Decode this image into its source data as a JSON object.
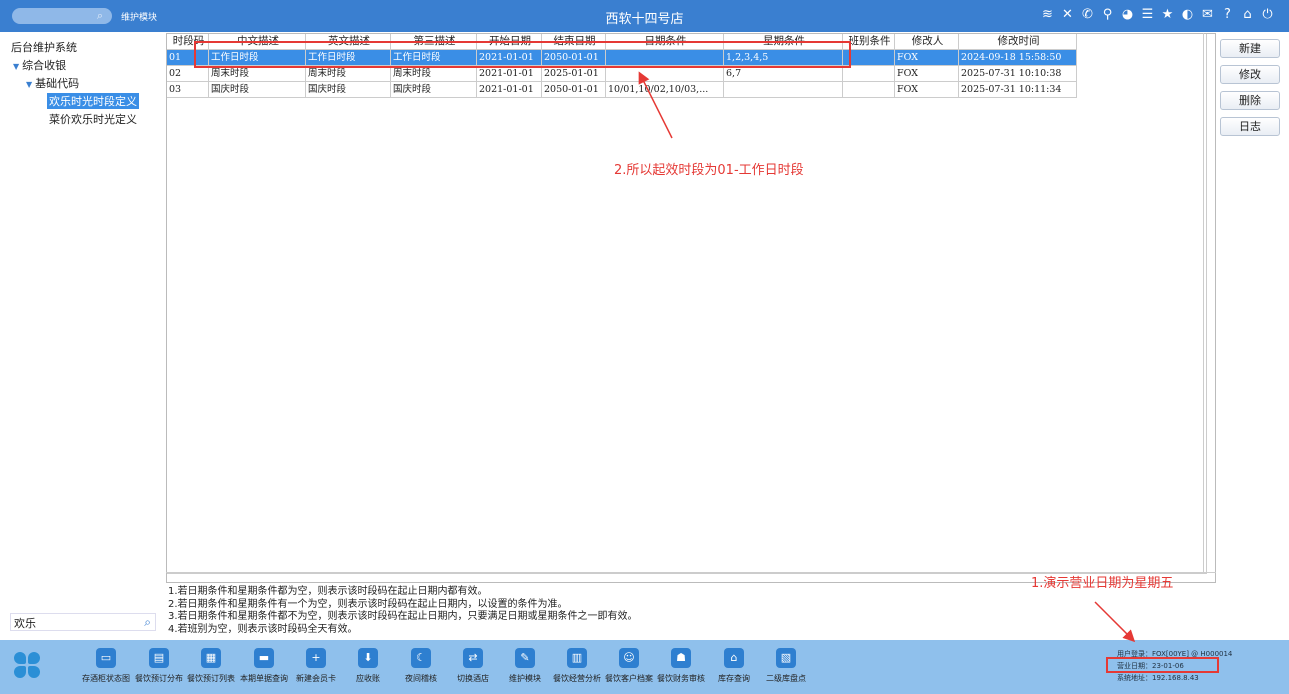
{
  "topbar": {
    "module_label": "维护模块",
    "store_title": "西软十四号店",
    "icons": [
      "wifi-icon",
      "tools-icon",
      "phone-icon",
      "search-person-icon",
      "palette-icon",
      "menu-icon",
      "star-icon",
      "theme-icon",
      "mail-icon",
      "help-icon",
      "home-icon",
      "power-icon"
    ]
  },
  "sidebar": {
    "root": "后台维护系统",
    "group": "综合收银",
    "sub": "基础代码",
    "item_selected": "欢乐时光时段定义",
    "item_other": "菜价欢乐时光定义",
    "search_value": "欢乐"
  },
  "table": {
    "headers": [
      "时段码",
      "中文描述",
      "英文描述",
      "第三描述",
      "开始日期",
      "结束日期",
      "日期条件",
      "星期条件",
      "班别条件",
      "修改人",
      "修改时间"
    ],
    "rows": [
      [
        "01",
        "工作日时段",
        "工作日时段",
        "工作日时段",
        "2021-01-01",
        "2050-01-01",
        "",
        "1,2,3,4,5",
        "",
        "FOX",
        "2024-09-18 15:58:50"
      ],
      [
        "02",
        "周末时段",
        "周末时段",
        "周末时段",
        "2021-01-01",
        "2025-01-01",
        "",
        "6,7",
        "",
        "FOX",
        "2025-07-31 10:10:38"
      ],
      [
        "03",
        "国庆时段",
        "国庆时段",
        "国庆时段",
        "2021-01-01",
        "2050-01-01",
        "10/01,10/02,10/03,...",
        "",
        "",
        "FOX",
        "2025-07-31 10:11:34"
      ]
    ]
  },
  "notes": [
    "1.若日期条件和星期条件都为空，则表示该时段码在起止日期内都有效。",
    "2.若日期条件和星期条件有一个为空，则表示该时段码在起止日期内，以设置的条件为准。",
    "3.若日期条件和星期条件都不为空，则表示该时段码在起止日期内，只要满足日期或星期条件之一即有效。",
    "4.若班别为空，则表示该时段码全天有效。"
  ],
  "buttons": {
    "new": "新建",
    "edit": "修改",
    "delete": "删除",
    "log": "日志"
  },
  "annotations": {
    "a2": "2.所以起效时段为01-工作日时段",
    "a1": "1.演示营业日期为星期五"
  },
  "taskbar": [
    {
      "label": "存酒柜状态图",
      "icon": "wine-cabinet-icon"
    },
    {
      "label": "餐饮预订分布",
      "icon": "booking-distribution-icon"
    },
    {
      "label": "餐饮预订列表",
      "icon": "booking-list-icon"
    },
    {
      "label": "本期单据查询",
      "icon": "bill-query-icon"
    },
    {
      "label": "新建会员卡",
      "icon": "new-member-card-icon"
    },
    {
      "label": "应收账",
      "icon": "receivable-icon"
    },
    {
      "label": "夜间稽核",
      "icon": "night-audit-icon"
    },
    {
      "label": "切换酒店",
      "icon": "switch-hotel-icon"
    },
    {
      "label": "维护模块",
      "icon": "maintenance-icon"
    },
    {
      "label": "餐饮经营分析",
      "icon": "analysis-icon"
    },
    {
      "label": "餐饮客户档案",
      "icon": "customer-file-icon"
    },
    {
      "label": "餐饮财务审核",
      "icon": "finance-audit-icon"
    },
    {
      "label": "库存查询",
      "icon": "stock-query-icon"
    },
    {
      "label": "二级库盘点",
      "icon": "inventory-count-icon"
    }
  ],
  "status": {
    "user": "用户登录：FOX[00YE] @ H000014",
    "biz_date": "营业日期：23-01-06",
    "sys_addr": "系统地址：192.168.8.43"
  },
  "colors": {
    "topbar": "#3a7fd0",
    "bottombar": "#8fc0ec",
    "selected": "#3a8ee6",
    "annotation": "#e53935"
  }
}
